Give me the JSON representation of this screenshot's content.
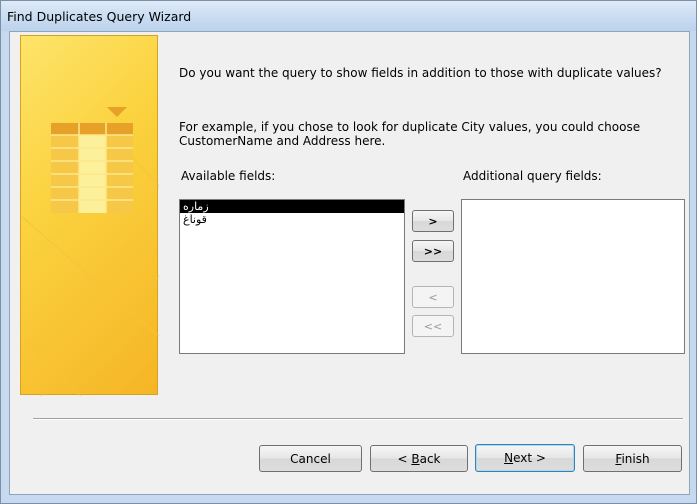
{
  "window": {
    "title": "Find Duplicates Query Wizard"
  },
  "main": {
    "question": "Do you want the query to show fields in addition to those with duplicate values?",
    "example_line1": "For example, if you chose to look for duplicate City values, you could choose",
    "example_line2": "CustomerName and Address here."
  },
  "available": {
    "label": "Available fields:",
    "items": [
      "زماره",
      "قوناغ"
    ],
    "selected_index": 0
  },
  "additional": {
    "label": "Additional query fields:",
    "items": []
  },
  "move_buttons": {
    "add_one": ">",
    "add_all": ">>",
    "remove_one": "<",
    "remove_all": "<<"
  },
  "footer": {
    "cancel": "Cancel",
    "back_prefix": "< ",
    "back_mnemonic": "B",
    "back_rest": "ack",
    "next_mnemonic": "N",
    "next_rest": "ext >",
    "finish_mnemonic": "F",
    "finish_rest": "inish"
  }
}
